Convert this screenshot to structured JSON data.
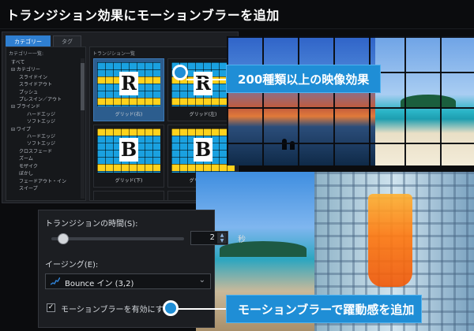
{
  "title": "トランジション効果にモーションブラーを追加",
  "app": {
    "tabs": [
      {
        "label": "カテゴリー"
      },
      {
        "label": "タグ"
      }
    ],
    "category_panel_title": "カテゴリー一覧:",
    "list_panel_title": "トランジション一覧",
    "tree": [
      "すべて",
      "⊟ カテゴリー",
      "スライドイン",
      "スライドアウト",
      "プッシュ",
      "プレスイン／アウト",
      "⊟ ブラインド",
      "ハードエッジ",
      "ソフトエッジ",
      "⊟ ワイプ",
      "ハードエッジ",
      "ソフトエッジ",
      "クロスフェード",
      "ズーム",
      "モザイク",
      "ぼかし",
      "フェードアウト・イン",
      "スイープ"
    ],
    "transitions": [
      {
        "label": "グリッド(右)",
        "letter": "R"
      },
      {
        "label": "グリッド(左)",
        "letter": "R"
      },
      {
        "label": "グリッド(下)",
        "letter": "B"
      },
      {
        "label": "グリッド(上)",
        "letter": "B"
      }
    ]
  },
  "callouts": {
    "top": "200種類以上の映像効果",
    "bottom": "モーションブラーで躍動感を追加"
  },
  "settings": {
    "duration_label": "トランジションの時間(S):",
    "duration_value": "2",
    "duration_unit": "秒",
    "slider_level": 0.05,
    "easing_label": "イージング(E):",
    "easing_value": "Bounce イン (3,2)",
    "motion_blur_label": "モーションブラーを有効にする",
    "motion_blur_checked": true
  },
  "colors": {
    "accent": "#1f8ed6",
    "selected": "#2c5d8e"
  }
}
